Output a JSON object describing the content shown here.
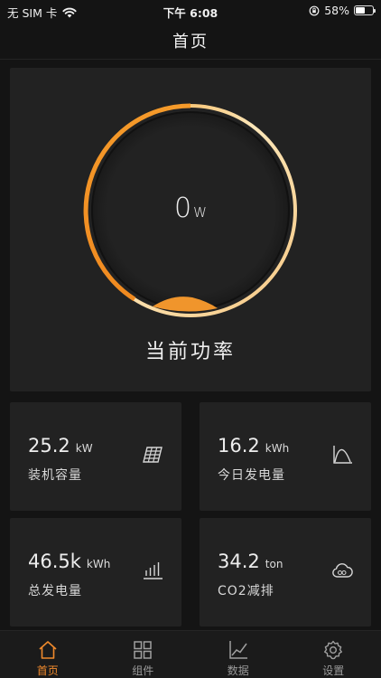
{
  "status_bar": {
    "carrier": "无 SIM 卡",
    "time": "下午 6:08",
    "battery": "58%",
    "battery_level": 0.58
  },
  "nav": {
    "title": "首页"
  },
  "power": {
    "value": "0",
    "unit": "W",
    "label": "当前功率",
    "accent_color": "#f09a30"
  },
  "stats": [
    {
      "value": "25.2",
      "unit": "kW",
      "label": "装机容量",
      "icon": "solar-panel-icon"
    },
    {
      "value": "16.2",
      "unit": "kWh",
      "label": "今日发电量",
      "icon": "curve-chart-icon"
    },
    {
      "value": "46.5k",
      "unit": "kWh",
      "label": "总发电量",
      "icon": "bar-chart-icon"
    },
    {
      "value": "34.2",
      "unit": "ton",
      "label": "CO2减排",
      "icon": "co2-cloud-icon"
    }
  ],
  "tabs": [
    {
      "label": "首页",
      "icon": "home-icon",
      "active": true
    },
    {
      "label": "组件",
      "icon": "grid-icon",
      "active": false
    },
    {
      "label": "数据",
      "icon": "line-chart-icon",
      "active": false
    },
    {
      "label": "设置",
      "icon": "gear-icon",
      "active": false
    }
  ],
  "colors": {
    "accent": "#f08a2c",
    "background": "#141414",
    "card": "#222222"
  }
}
